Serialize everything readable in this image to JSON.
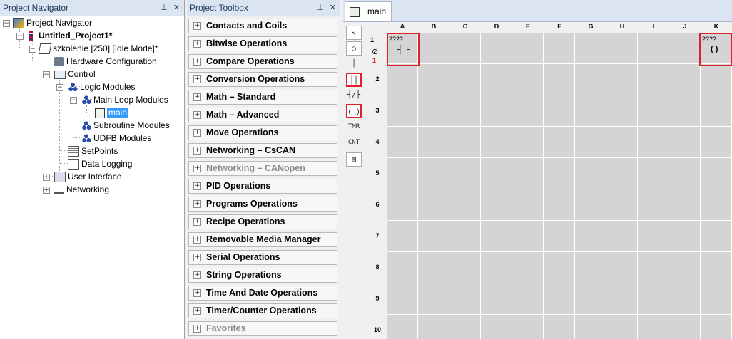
{
  "nav": {
    "title": "Project Navigator",
    "tree": [
      {
        "label": "Project Navigator",
        "icon": "project-navigator-icon"
      },
      {
        "label": "Untitled_Project1*",
        "icon": "project-icon"
      },
      {
        "label": "szkolenie [250] [Idle Mode]*",
        "icon": "controller-icon"
      },
      {
        "label": "Hardware Configuration",
        "icon": "hardware-icon"
      },
      {
        "label": "Control",
        "icon": "monitor-icon"
      },
      {
        "label": "Logic Modules",
        "icon": "logic-modules-icon"
      },
      {
        "label": "Main Loop Modules",
        "icon": "modules-icon"
      },
      {
        "label": "main",
        "icon": "ladder-file-icon"
      },
      {
        "label": "Subroutine Modules",
        "icon": "modules-icon"
      },
      {
        "label": "UDFB Modules",
        "icon": "modules-icon"
      },
      {
        "label": "SetPoints",
        "icon": "setpoints-icon"
      },
      {
        "label": "Data Logging",
        "icon": "data-logging-icon"
      },
      {
        "label": "User Interface",
        "icon": "user-interface-icon"
      },
      {
        "label": "Networking",
        "icon": "networking-icon"
      }
    ]
  },
  "toolbox": {
    "title": "Project Toolbox",
    "groups": [
      "Contacts and Coils",
      "Bitwise Operations",
      "Compare Operations",
      "Conversion Operations",
      "Math – Standard",
      "Math – Advanced",
      "Move Operations",
      "Networking – CsCAN",
      "Networking – CANopen",
      "PID Operations",
      "Programs Operations",
      "Recipe Operations",
      "Removable Media Manager",
      "Serial Operations",
      "String Operations",
      "Time And Date Operations",
      "Timer/Counter Operations",
      "Favorites"
    ],
    "disabled": [
      "Networking – CANopen",
      "Favorites"
    ]
  },
  "editor": {
    "tab": "main",
    "palette": [
      "↖",
      "○",
      "│",
      "┤├",
      "┤/├",
      "(‿)",
      "TMR",
      "CNT",
      "▤"
    ],
    "columns": [
      "A",
      "B",
      "C",
      "D",
      "E",
      "F",
      "G",
      "H",
      "I",
      "J",
      "K"
    ],
    "rows": [
      "1",
      "2",
      "3",
      "4",
      "5",
      "6",
      "7",
      "8",
      "9",
      "10"
    ],
    "rung_number": "1",
    "contact_operand": "????",
    "coil_operand": "????"
  },
  "colors": {
    "highlight": "#e0202a",
    "selection": "#3399ff",
    "header": "#dbe5f1"
  }
}
